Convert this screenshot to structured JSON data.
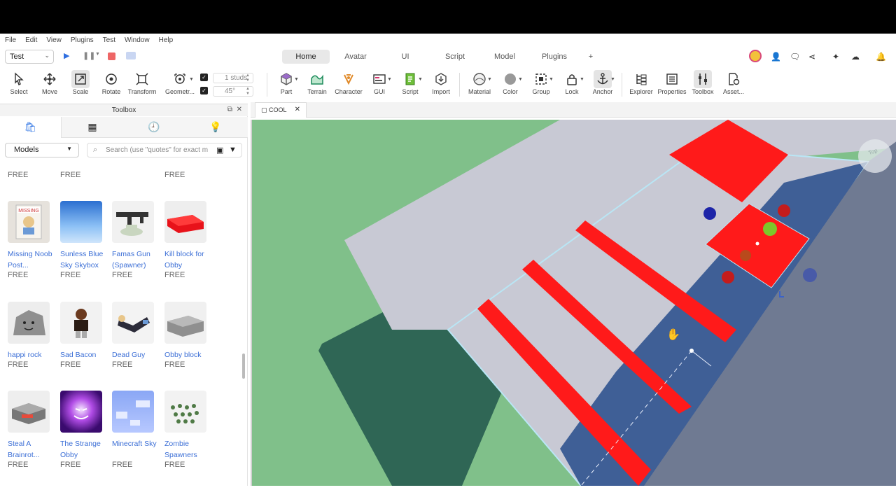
{
  "menu": [
    "File",
    "Edit",
    "View",
    "Plugins",
    "Test",
    "Window",
    "Help"
  ],
  "mode_select": "Test",
  "ribbon_tabs": [
    "Home",
    "Avatar",
    "UI",
    "Script",
    "Model",
    "Plugins",
    "+"
  ],
  "ribbon_active": "Home",
  "tools": {
    "select": "Select",
    "move": "Move",
    "scale": "Scale",
    "rotate": "Rotate",
    "transform": "Transform",
    "geometry": "Geometr...",
    "part": "Part",
    "terrain": "Terrain",
    "character": "Character",
    "gui": "GUI",
    "script": "Script",
    "import": "Import",
    "material": "Material",
    "color": "Color",
    "group": "Group",
    "lock": "Lock",
    "anchor": "Anchor",
    "explorer": "Explorer",
    "properties": "Properties",
    "toolbox": "Toolbox",
    "asset": "Asset..."
  },
  "snap": {
    "move": "1 studs",
    "rotate": "45°"
  },
  "toolbox": {
    "title": "Toolbox",
    "category": "Models",
    "search_placeholder": "Search (use \"quotes\" for exact m",
    "top_prices": [
      "FREE",
      "FREE",
      "FREE"
    ],
    "items": [
      {
        "name": "Missing Noob Post...",
        "price": "FREE",
        "badge": "MISSING"
      },
      {
        "name": "Sunless Blue Sky Skybox",
        "price": "FREE"
      },
      {
        "name": "Famas Gun (Spawner)",
        "price": "FREE"
      },
      {
        "name": "Kill block for Obby",
        "price": "FREE"
      },
      {
        "name": "happi rock",
        "price": "FREE"
      },
      {
        "name": "Sad Bacon",
        "price": "FREE"
      },
      {
        "name": "Dead Guy",
        "price": "FREE"
      },
      {
        "name": "Obby block",
        "price": "FREE"
      },
      {
        "name": "Steal A Brainrot...",
        "price": "FREE"
      },
      {
        "name": "The Strange Obby",
        "price": "FREE"
      },
      {
        "name": "Minecraft Sky",
        "price": "FREE"
      },
      {
        "name": "Zombie Spawners",
        "price": "FREE"
      }
    ]
  },
  "doc_tab": "COOL",
  "viewcube_label": "Top",
  "colors": {
    "accent": "#3d7ee6",
    "kill_red": "#ff1a1a",
    "baseplate": "#80c08a",
    "lane_blue": "#3f5f96",
    "platform_gray": "#c8c9d4"
  }
}
